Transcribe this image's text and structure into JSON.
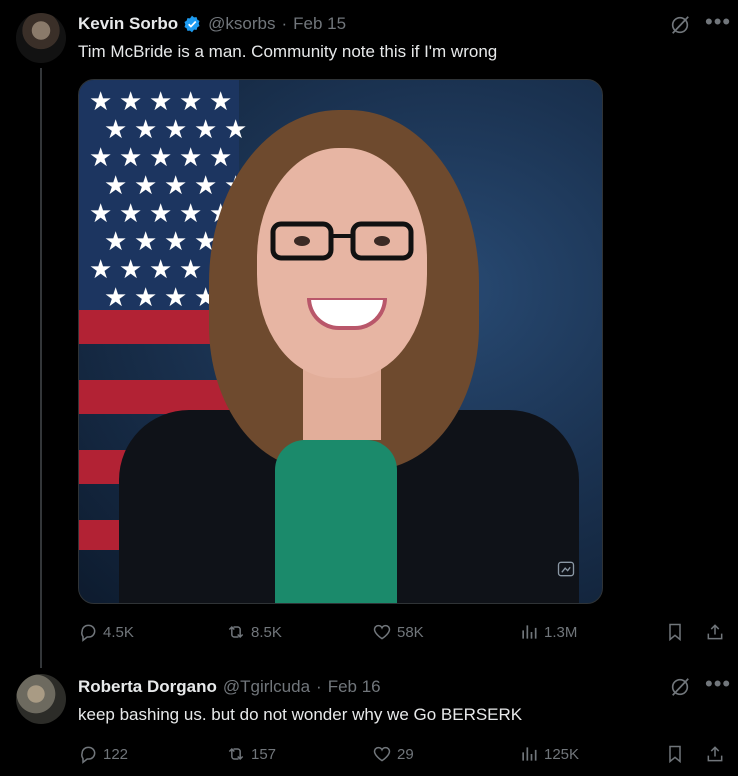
{
  "tweet": {
    "author_name": "Kevin Sorbo",
    "handle": "@ksorbs",
    "separator": "·",
    "date": "Feb 15",
    "text": "Tim McBride is a man. Community note this if I'm wrong",
    "more_icon": "•••",
    "stats": {
      "replies": "4.5K",
      "reposts": "8.5K",
      "likes": "58K",
      "views": "1.3M"
    }
  },
  "reply": {
    "author_name": "Roberta Dorgano",
    "handle": "@Tgirlcuda",
    "separator": "·",
    "date": "Feb 16",
    "text": "keep bashing us. but do not wonder why we Go BERSERK",
    "more_icon": "•••",
    "stats": {
      "replies": "122",
      "reposts": "157",
      "likes": "29",
      "views": "125K"
    }
  },
  "icons": [
    "verified-badge-icon",
    "grok-icon",
    "more-icon",
    "reply-icon",
    "repost-icon",
    "like-icon",
    "views-icon",
    "bookmark-icon",
    "share-icon",
    "alt-text-icon"
  ],
  "colors": {
    "background": "#000000",
    "text": "#e7e9ea",
    "secondary": "#71767b",
    "verified": "#1d9bf0",
    "thread_line": "#333639"
  }
}
